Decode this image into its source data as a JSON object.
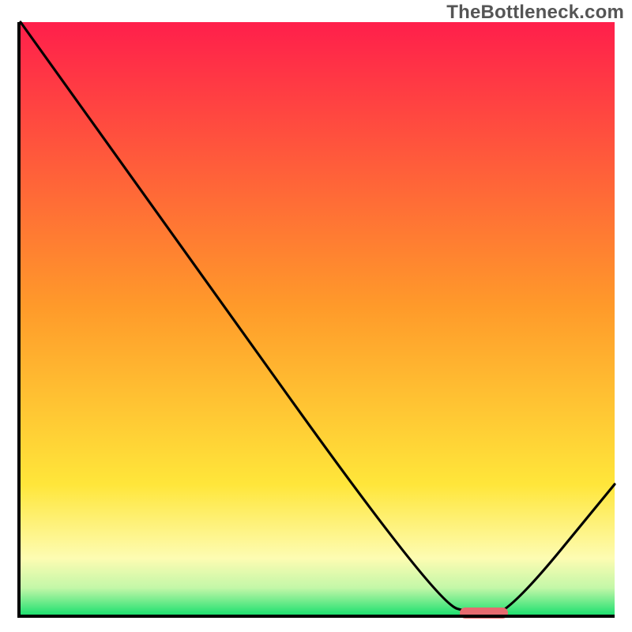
{
  "watermark": "TheBottleneck.com",
  "chart_data": {
    "type": "line",
    "title": "",
    "xlabel": "",
    "ylabel": "",
    "xlim": [
      0,
      100
    ],
    "ylim": [
      0,
      100
    ],
    "series": [
      {
        "name": "bottleneck-curve",
        "x": [
          0,
          20,
          70,
          77,
          82,
          100
        ],
        "y": [
          100,
          72,
          2,
          0,
          0,
          22
        ]
      }
    ],
    "marker": {
      "name": "optimal-range",
      "x_from": 74,
      "x_to": 82,
      "color": "#e66a6f"
    },
    "gradient_stops": [
      {
        "pos": 0.0,
        "color": "#ff1f4b"
      },
      {
        "pos": 0.48,
        "color": "#ff9a2a"
      },
      {
        "pos": 0.78,
        "color": "#ffe63a"
      },
      {
        "pos": 0.905,
        "color": "#fdfcb2"
      },
      {
        "pos": 0.955,
        "color": "#c3f7a8"
      },
      {
        "pos": 1.0,
        "color": "#1fe070"
      }
    ]
  }
}
